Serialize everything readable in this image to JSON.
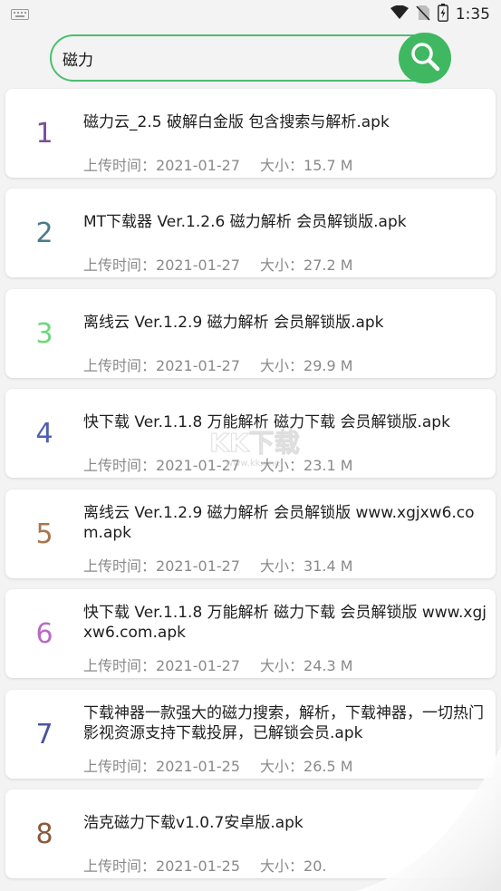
{
  "status_bar": {
    "time": "1:35",
    "icons": [
      "keyboard-icon",
      "wifi-icon",
      "no-sim-icon",
      "battery-icon"
    ]
  },
  "search": {
    "value": "磁力",
    "placeholder": "",
    "button_icon": "search-icon",
    "accent": "#3fb861"
  },
  "labels": {
    "upload_time": "上传时间：",
    "size": "大小："
  },
  "results": [
    {
      "num": "1",
      "color": "#7b4e9a",
      "title": "磁力云_2.5 破解白金版 包含搜索与解析.apk",
      "date": "2021-01-27",
      "size": "15.7 M"
    },
    {
      "num": "2",
      "color": "#4a7b8c",
      "title": "MT下载器 Ver.1.2.6 磁力解析 会员解锁版.apk",
      "date": "2021-01-27",
      "size": "27.2 M"
    },
    {
      "num": "3",
      "color": "#6cd87a",
      "title": "离线云 Ver.1.2.9 磁力解析 会员解锁版.apk",
      "date": "2021-01-27",
      "size": "29.9 M"
    },
    {
      "num": "4",
      "color": "#4f5fb0",
      "title": "快下载 Ver.1.1.8 万能解析 磁力下载 会员解锁版.apk",
      "date": "2021-01-27",
      "size": "23.1 M"
    },
    {
      "num": "5",
      "color": "#a8764e",
      "title": "离线云 Ver.1.2.9 磁力解析 会员解锁版 www.xgjxw6.com.apk",
      "date": "2021-01-27",
      "size": "31.4 M"
    },
    {
      "num": "6",
      "color": "#b86ac4",
      "title": "快下载 Ver.1.1.8 万能解析 磁力下载 会员解锁版 www.xgjxw6.com.apk",
      "date": "2021-01-27",
      "size": "24.3 M"
    },
    {
      "num": "7",
      "color": "#4a55a0",
      "title": "下载神器一款强大的磁力搜索，解析，下载神器，一切热门影视资源支持下载投屏，已解锁会员.apk",
      "date": "2021-01-25",
      "size": "26.5 M"
    },
    {
      "num": "8",
      "color": "#8a5a3a",
      "title": "浩克磁力下载v1.0.7安卓版.apk",
      "date": "2021-01-25",
      "size": "20."
    }
  ],
  "watermark": {
    "text": "KK下载",
    "sub": "www.kkx.net"
  }
}
